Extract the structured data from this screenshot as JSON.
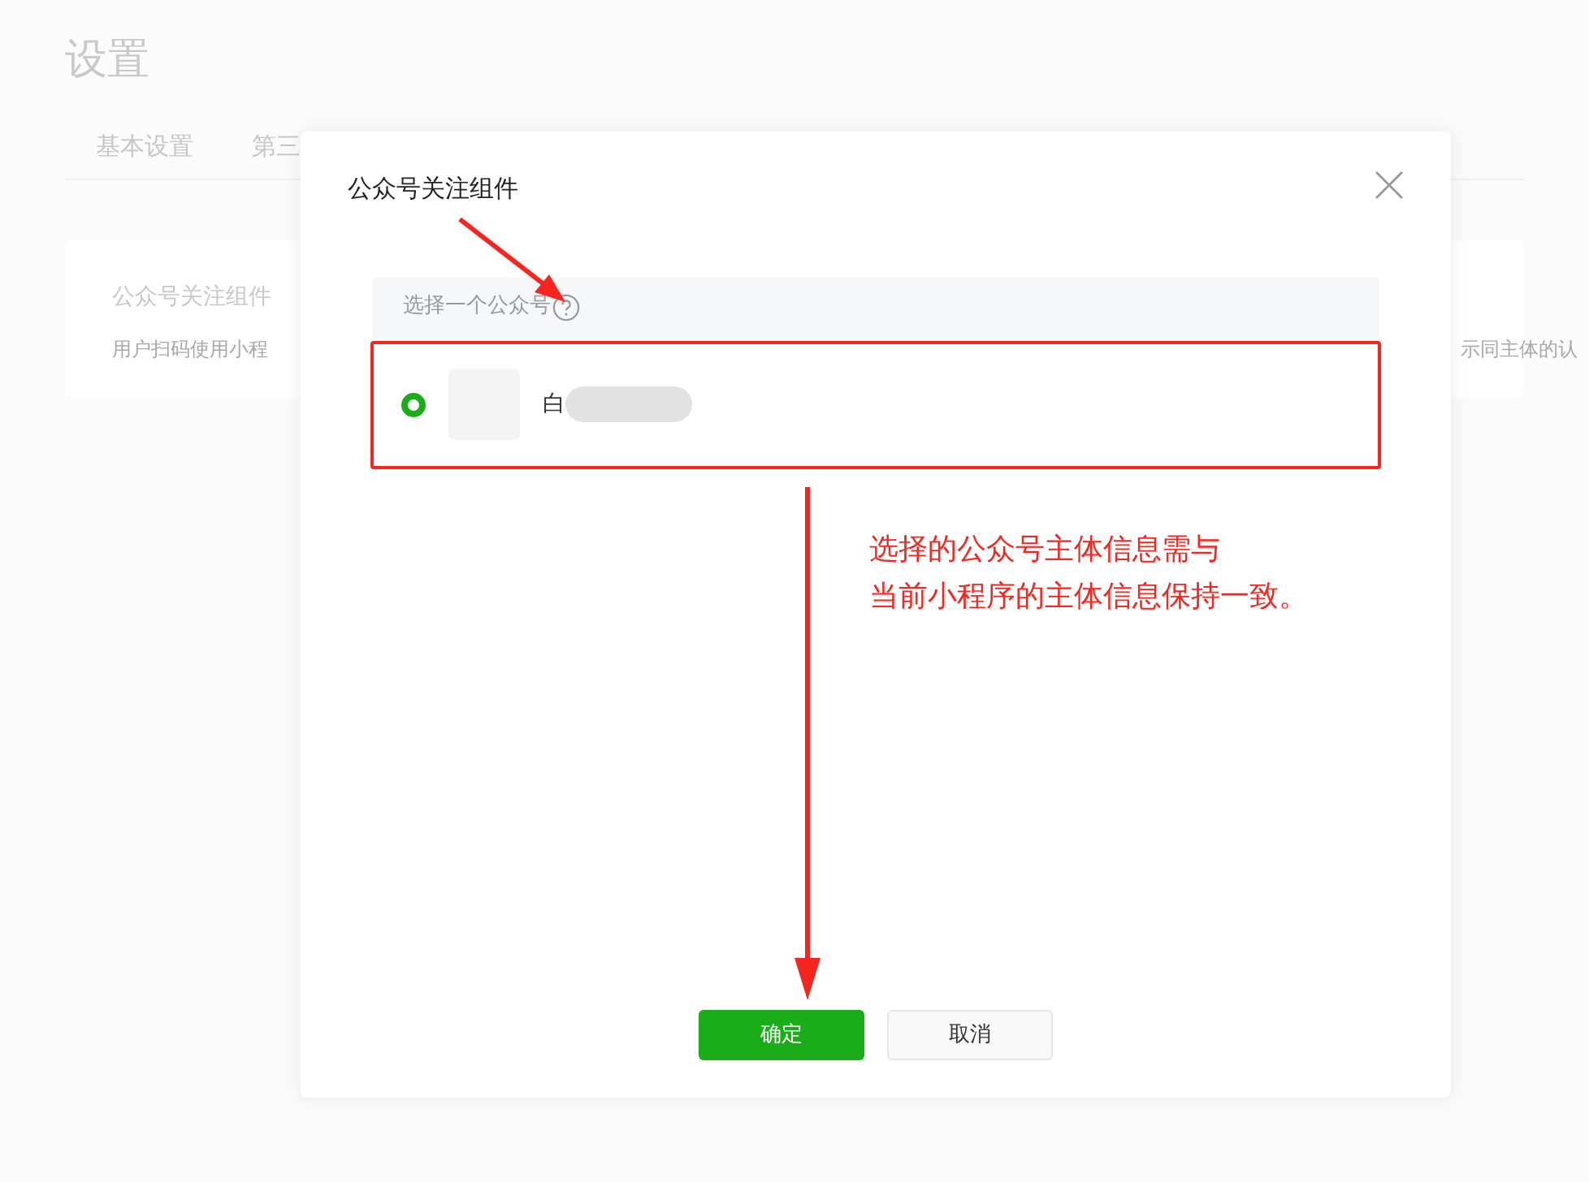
{
  "page": {
    "title": "设置",
    "tabs": [
      "基本设置",
      "第三"
    ],
    "card": {
      "title": "公众号关注组件",
      "description_left": "用户扫码使用小程",
      "description_right": "示同主体的认"
    }
  },
  "dialog": {
    "title": "公众号关注组件",
    "section_label": "选择一个公众号",
    "options": [
      {
        "name": "白",
        "selected": true
      }
    ],
    "buttons": [
      {
        "label": "确定",
        "kind": "primary"
      },
      {
        "label": "取消",
        "kind": "secondary"
      }
    ]
  },
  "annotation": {
    "lines": [
      "选择的公众号主体信息需与",
      "当前小程序的主体信息保持一致。"
    ]
  }
}
